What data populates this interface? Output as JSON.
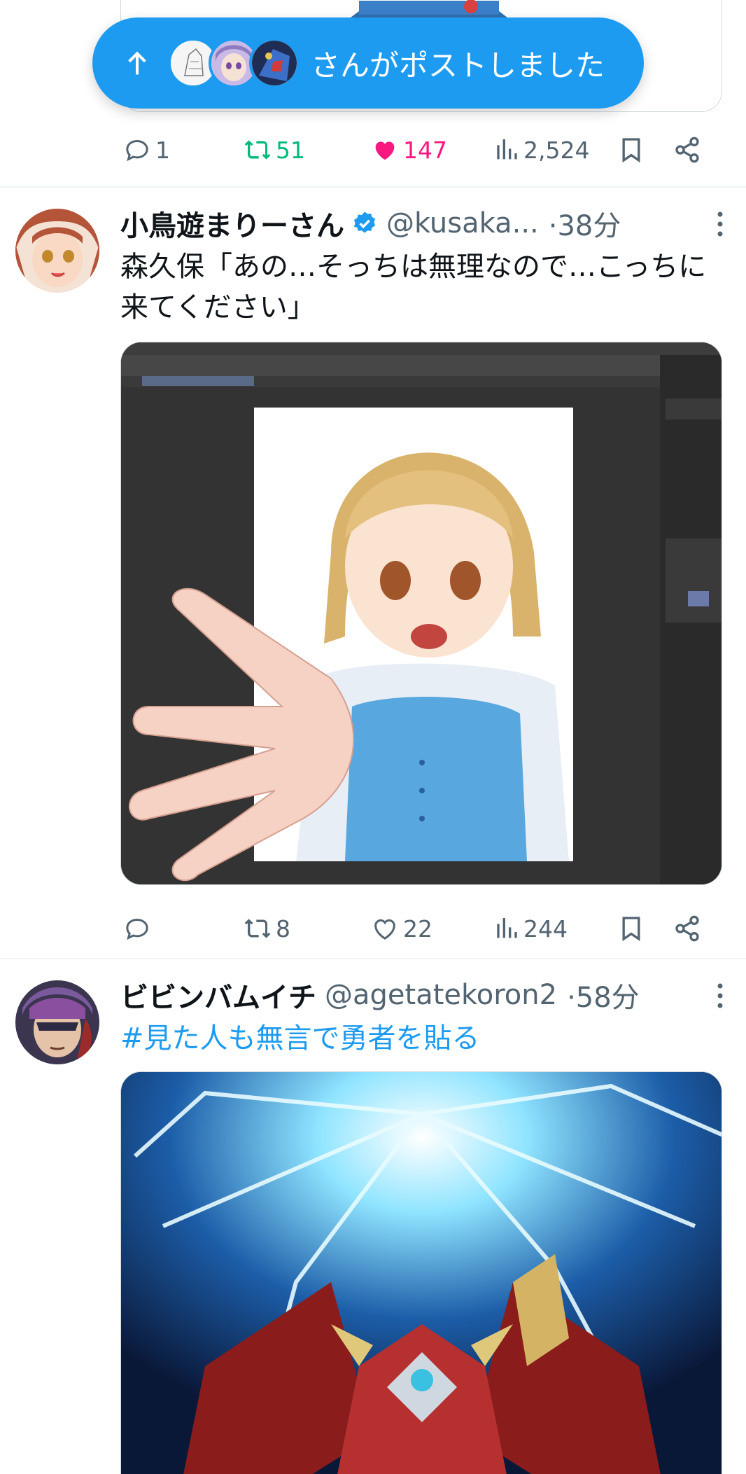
{
  "new_posts_pill": {
    "label": "さんがポストしました"
  },
  "posts": [
    {
      "actions": {
        "replies": "1",
        "reposts": "51",
        "likes": "147",
        "views": "2,524"
      }
    },
    {
      "author": {
        "display_name": "小鳥遊まりーさん",
        "handle": "@kusaka...",
        "verified": true
      },
      "time": "·38分",
      "text": "森久保「あの…そっちは無理なので…こっちに来てください」",
      "actions": {
        "replies": "",
        "reposts": "8",
        "likes": "22",
        "views": "244"
      }
    },
    {
      "author": {
        "display_name": "ビビンバムイチ",
        "handle": "@agetatekoron2",
        "verified": false
      },
      "time": "·58分",
      "text": "#見た人も無言で勇者を貼る"
    }
  ],
  "colors": {
    "accent": "#1d9bf0",
    "repost_active": "#00ba7c",
    "like_active": "#f91880",
    "secondary_text": "#536471",
    "divider": "#eff3f4"
  },
  "icons": [
    "reply-icon",
    "repost-icon",
    "like-icon",
    "views-icon",
    "bookmark-icon",
    "share-icon",
    "verified-badge-icon",
    "more-icon",
    "arrow-up-icon"
  ]
}
